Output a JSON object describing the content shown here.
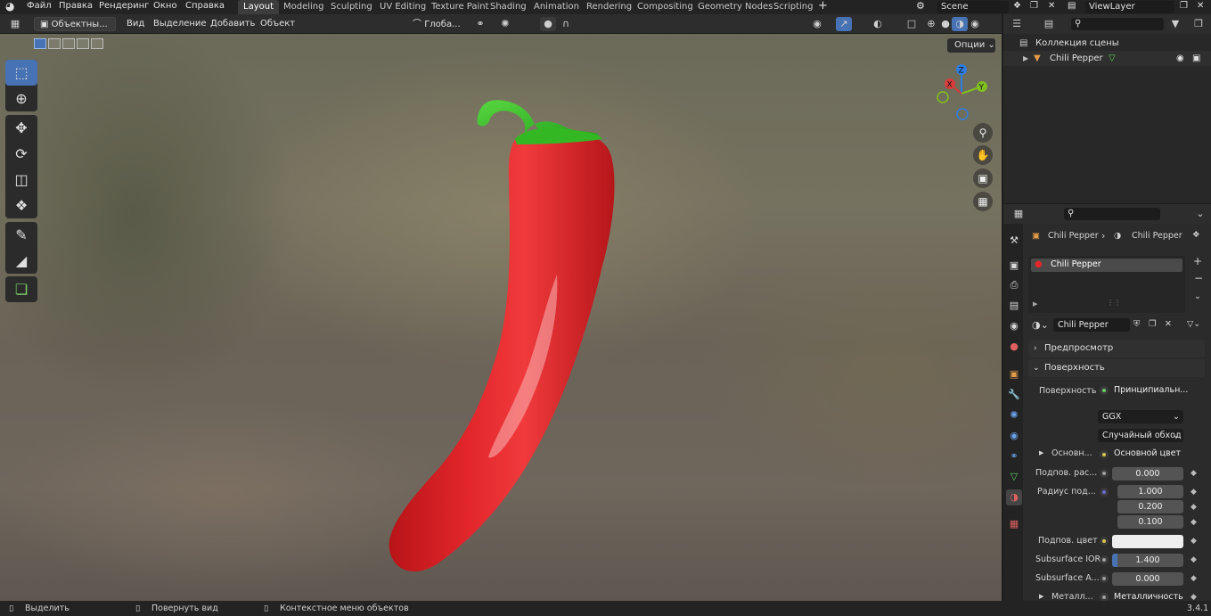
{
  "app": {
    "menu": [
      "Файл",
      "Правка",
      "Рендеринг",
      "Окно",
      "Справка"
    ],
    "workspaces": [
      "Layout",
      "Modeling",
      "Sculpting",
      "UV Editing",
      "Texture Paint",
      "Shading",
      "Animation",
      "Rendering",
      "Compositing",
      "Geometry Nodes",
      "Scripting"
    ],
    "active_workspace": "Layout",
    "scene": "Scene",
    "view_layer": "ViewLayer",
    "version": "3.4.1"
  },
  "viewport_header": {
    "mode": "Объектны...",
    "menus": [
      "Вид",
      "Выделение",
      "Добавить",
      "Объект"
    ],
    "transform_orientation": "Глоба...",
    "options": "Опции"
  },
  "gizmo": {
    "x": "X",
    "y": "Y",
    "z": "Z"
  },
  "outliner": {
    "collection": "Коллекция сцены",
    "object": "Chili Pepper"
  },
  "properties": {
    "breadcrumb_object": "Chili Pepper",
    "breadcrumb_material": "Chili Pepper",
    "material_slot": "Chili Pepper",
    "material_name": "Chili Pepper",
    "panels": {
      "preview": "Предпросмотр",
      "surface": "Поверхность"
    },
    "surface_label": "Поверхность",
    "surface_shader": "Принципиальн...",
    "distribution": "GGX",
    "subsurface_method": "Случайный обход",
    "base_color_label": "Основн...",
    "base_color_value": "Основной цвет",
    "subsurface_weight_label": "Подпов. рас...",
    "subsurface_weight": "0.000",
    "subsurface_radius_label": "Радиус под...",
    "subsurface_radius": [
      "1.000",
      "0.200",
      "0.100"
    ],
    "subsurface_color_label": "Подпов. цвет",
    "subsurface_ior_label": "Subsurface IOR",
    "subsurface_ior": "1.400",
    "subsurface_ior_fraction": 0.07,
    "subsurface_aniso_label": "Subsurface A...",
    "subsurface_aniso": "0.000",
    "metallic_label": "Металл...",
    "metallic_value": "Металличность"
  },
  "statusbar": {
    "select": "Выделить",
    "rotate": "Повернуть вид",
    "context": "Контекстное меню объектов"
  },
  "colors": {
    "accent": "#4772b3",
    "pepper": "#e0262a",
    "stem": "#3fbf2a"
  }
}
